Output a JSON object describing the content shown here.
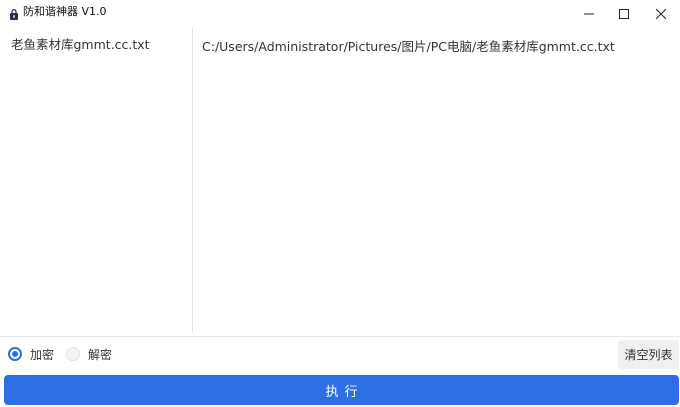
{
  "window": {
    "title": "防和谐神器 V1.0",
    "icon": "lock-file-icon",
    "controls": {
      "minimize": "minimize-icon",
      "maximize": "maximize-icon",
      "close": "close-icon"
    }
  },
  "file_list": {
    "items": [
      "老鱼素材库gmmt.cc.txt"
    ]
  },
  "path_list": {
    "items": [
      "C:/Users/Administrator/Pictures/图片/PC电脑/老鱼素材库gmmt.cc.txt"
    ]
  },
  "mode": {
    "options": [
      {
        "label": "加密",
        "checked": true
      },
      {
        "label": "解密",
        "checked": false
      }
    ]
  },
  "buttons": {
    "clear_label": "清空列表",
    "execute_label": "执行"
  },
  "colors": {
    "accent": "#2f6fe4",
    "button_bg": "#f0f0f0"
  }
}
